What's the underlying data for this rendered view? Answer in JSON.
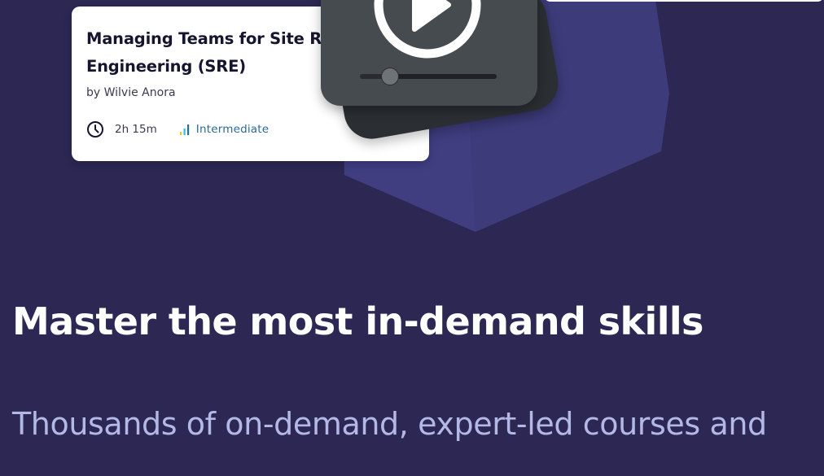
{
  "course_card": {
    "title": "Managing Teams for Site Reliability Engineering (SRE)",
    "author": "by Wilvie Anora",
    "duration": "2h 15m",
    "level": "Intermediate",
    "duration_icon": "clock-icon",
    "level_icon": "signal-bars-icon"
  },
  "video_player": {
    "icon": "play-icon",
    "progress": 0.22
  },
  "hero": {
    "headline": "Master the most in-demand skills",
    "subheadline": "Thousands of on-demand, expert-led courses and"
  },
  "colors": {
    "background": "#2c2753",
    "hexagon": "#3d3b7a",
    "headline": "#ffffff",
    "subheadline": "#b4b8e6",
    "level_text": "#2a6b96",
    "signal_bars": [
      "#f5c518",
      "#27c3ea",
      "#2a6b96"
    ]
  }
}
